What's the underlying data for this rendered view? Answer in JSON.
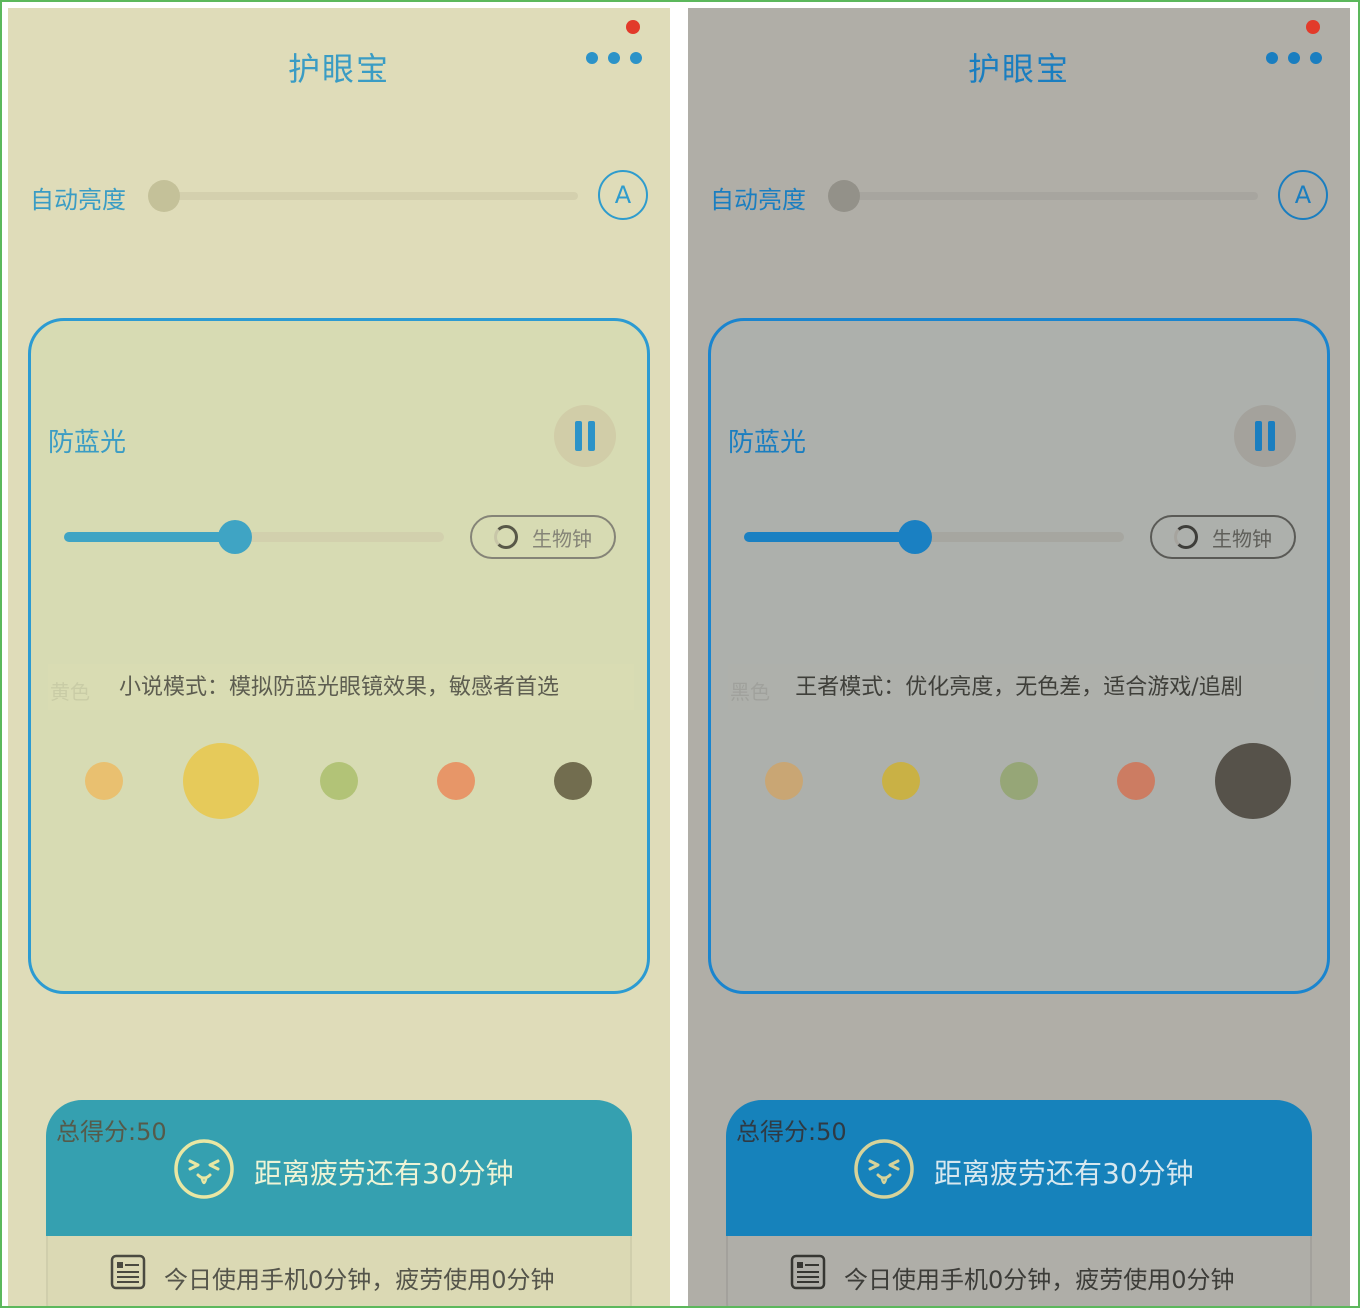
{
  "screens": [
    {
      "theme": "yellow",
      "header": {
        "title": "护眼宝",
        "menu_icon": "more-dots-icon",
        "notification_color": "#e23a2a"
      },
      "brightness": {
        "label": "自动亮度",
        "auto_label": "A",
        "level": 0
      },
      "filter": {
        "label": "防蓝光",
        "pause_icon": "pause-icon",
        "intensity": 0.45,
        "bioclock_label": "生物钟",
        "mode_ghost": "黄色",
        "mode_description": "小说模式：模拟防蓝光眼镜效果，敏感者首选",
        "swatches": [
          {
            "color": "#e9c070",
            "selected": false
          },
          {
            "color": "#e6ca5a",
            "selected": true
          },
          {
            "color": "#b2c377",
            "selected": false
          },
          {
            "color": "#e79668",
            "selected": false
          },
          {
            "color": "#726d4f",
            "selected": false
          }
        ]
      },
      "score": {
        "label": "总得分:50",
        "fatigue_text": "距离疲劳还有30分钟",
        "usage_text": "今日使用手机0分钟，疲劳使用0分钟"
      }
    },
    {
      "theme": "gray",
      "header": {
        "title": "护眼宝",
        "menu_icon": "more-dots-icon",
        "notification_color": "#e23a2a"
      },
      "brightness": {
        "label": "自动亮度",
        "auto_label": "A",
        "level": 0
      },
      "filter": {
        "label": "防蓝光",
        "pause_icon": "pause-icon",
        "intensity": 0.45,
        "bioclock_label": "生物钟",
        "mode_ghost": "黑色",
        "mode_description": "王者模式：优化亮度，无色差，适合游戏/追剧",
        "swatches": [
          {
            "color": "#c9a674",
            "selected": false
          },
          {
            "color": "#c9b145",
            "selected": false
          },
          {
            "color": "#96a677",
            "selected": false
          },
          {
            "color": "#cc7c62",
            "selected": false
          },
          {
            "color": "#56524a",
            "selected": true
          }
        ]
      },
      "score": {
        "label": "总得分:50",
        "fatigue_text": "距离疲劳还有30分钟",
        "usage_text": "今日使用手机0分钟，疲劳使用0分钟"
      }
    }
  ]
}
